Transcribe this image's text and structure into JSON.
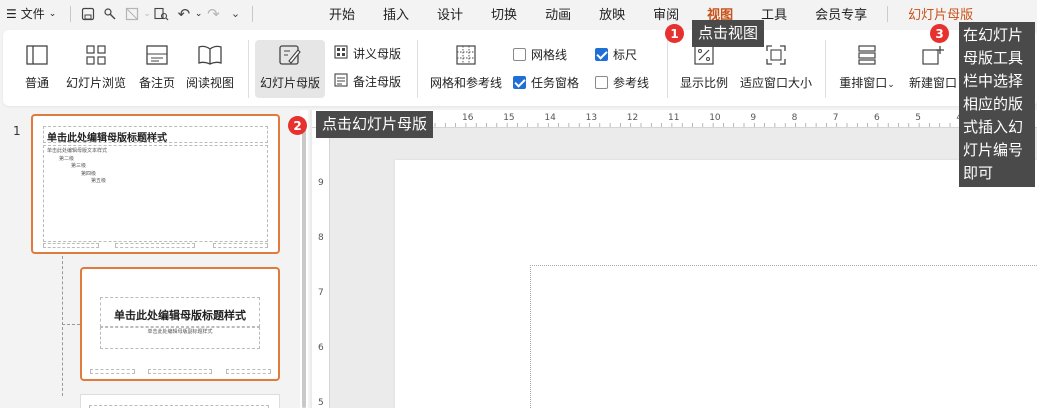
{
  "menubar": {
    "file_label": "文件",
    "tabs": [
      {
        "label": "开始"
      },
      {
        "label": "插入"
      },
      {
        "label": "设计"
      },
      {
        "label": "切换"
      },
      {
        "label": "动画"
      },
      {
        "label": "放映"
      },
      {
        "label": "审阅"
      },
      {
        "label": "视图",
        "active": true
      },
      {
        "label": "工具"
      },
      {
        "label": "会员专享"
      },
      {
        "label": "幻灯片母版",
        "special": true
      }
    ]
  },
  "ribbon": {
    "normal_label": "普通",
    "slide_sorter_label": "幻灯片浏览",
    "notes_page_label": "备注页",
    "reading_view_label": "阅读视图",
    "slide_master_label": "幻灯片母版",
    "handout_master_label": "讲义母版",
    "notes_master_label": "备注母版",
    "grid_guides_label": "网格和参考线",
    "gridlines_label": "网格线",
    "gridlines_checked": false,
    "task_pane_label": "任务窗格",
    "task_pane_checked": true,
    "ruler_label": "标尺",
    "ruler_checked": true,
    "guides_label": "参考线",
    "guides_checked": false,
    "zoom_label": "显示比例",
    "fit_window_label": "适应窗口大小",
    "arrange_label": "重排窗口",
    "new_window_label": "新建窗口"
  },
  "slides": {
    "number": "1",
    "master_title": "单击此处编辑母版标题样式",
    "master_text": "单击此处编辑母版文本样式",
    "level2": "第二级",
    "level3": "第三级",
    "level4": "第四级",
    "level5": "第五级",
    "layout_title": "单击此处编辑母版标题样式",
    "layout_subtitle": "单击此处编辑母版副标题样式"
  },
  "ruler": {
    "h_ticks": [
      "16",
      "15",
      "14",
      "13",
      "12",
      "11",
      "10",
      "9",
      "8",
      "7",
      "6",
      "5",
      "4"
    ],
    "v_ticks": [
      "9",
      "8",
      "7",
      "6",
      "5"
    ]
  },
  "annotations": {
    "step1_num": "1",
    "step1_text": "点击视图",
    "step2_num": "2",
    "step2_text": "点击幻灯片母版",
    "step3_num": "3",
    "step3_text": "在幻灯片母版工具栏中选择相应的版式插入幻灯片编号即可"
  },
  "colors": {
    "accent": "#c7521a",
    "badge": "#e6312e",
    "callout_bg": "#4a4a4a",
    "thumb_border": "#e07a3d",
    "checkbox": "#1f6fd4"
  }
}
